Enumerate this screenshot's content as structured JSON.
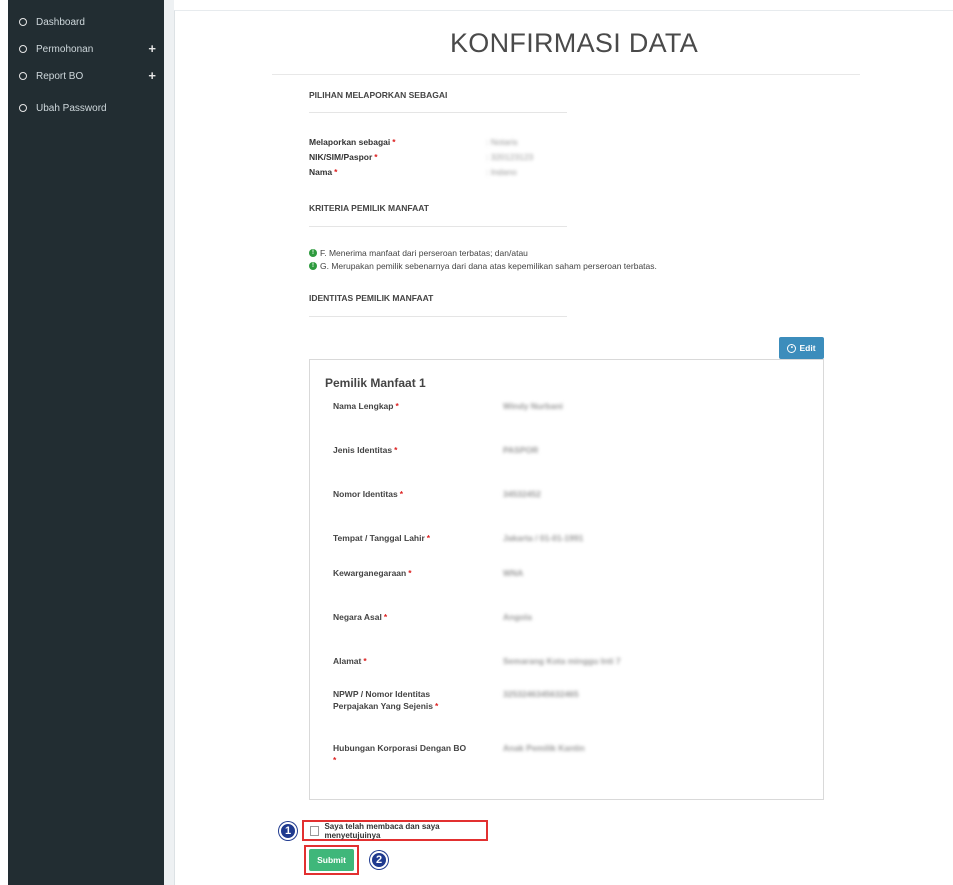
{
  "sidebar": {
    "items": [
      {
        "label": "Dashboard",
        "expand": ""
      },
      {
        "label": "Permohonan",
        "expand": "+"
      },
      {
        "label": "Report BO",
        "expand": "+"
      },
      {
        "label": "Ubah Password",
        "expand": ""
      }
    ]
  },
  "page": {
    "title": "KONFIRMASI DATA"
  },
  "section1": {
    "heading": "PILIHAN MELAPORKAN SEBAGAI",
    "fields": [
      {
        "label": "Melaporkan sebagai",
        "value": ": Notaris"
      },
      {
        "label": "NIK/SIM/Paspor",
        "value": ": 320123123"
      },
      {
        "label": "Nama",
        "value": ": Indano"
      }
    ]
  },
  "section2": {
    "heading": "KRITERIA PEMILIK MANFAAT",
    "criteria": [
      "F. Menerima manfaat dari perseroan terbatas; dan/atau",
      "G. Merupakan pemilik sebenarnya dari dana atas kepemilikan saham perseroan terbatas."
    ]
  },
  "section3": {
    "heading": "IDENTITAS PEMILIK MANFAAT"
  },
  "edit": {
    "label": "Edit"
  },
  "owner": {
    "title": "Pemilik Manfaat 1",
    "fields": [
      {
        "label": "Nama Lengkap",
        "value": "Windy Nurbani"
      },
      {
        "label": "Jenis Identitas",
        "value": "PASPOR"
      },
      {
        "label": "Nomor Identitas",
        "value": "34532452"
      },
      {
        "label": "Tempat / Tanggal Lahir",
        "value": "Jakarta / 01-01-1991"
      },
      {
        "label": "Kewarganegaraan",
        "value": "WNA"
      },
      {
        "label": "Negara Asal",
        "value": "Angola"
      },
      {
        "label": "Alamat",
        "value": "Semarang Kota minggu Inti 7"
      },
      {
        "label": "NPWP / Nomor Identitas Perpajakan Yang Sejenis",
        "value": "3253246345632465"
      },
      {
        "label": "Hubungan Korporasi Dengan BO",
        "value": "Anak Pemilik Kantin"
      }
    ]
  },
  "required_mark": "*",
  "agreement": {
    "label": "Saya telah membaca dan saya menyetujuinya"
  },
  "submit": {
    "label": "Submit"
  },
  "callouts": [
    "1",
    "2"
  ],
  "colors": {
    "sidebar": "#222d32",
    "primary": "#3c8dbc",
    "success": "#3fb77a",
    "highlight": "#e23030",
    "badge": "#1f3a8f"
  }
}
